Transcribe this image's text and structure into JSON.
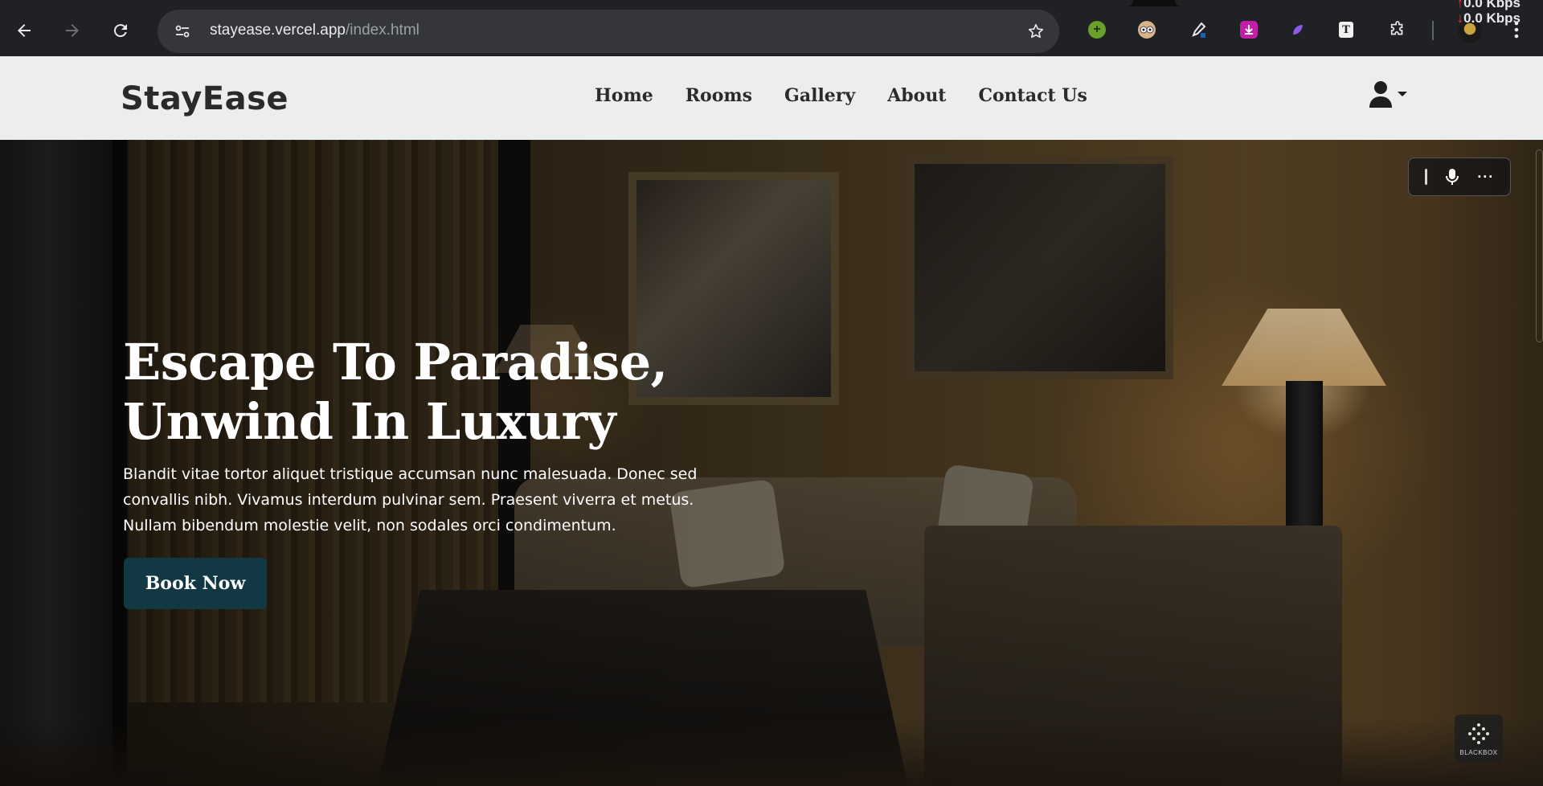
{
  "browser": {
    "url_host": "stayease.vercel.app",
    "url_path": "/index.html",
    "net_speed_up": "0.0 Kbps",
    "net_speed_down": "0.0 Kbps"
  },
  "site": {
    "brand": "StayEase",
    "nav": [
      "Home",
      "Rooms",
      "Gallery",
      "About",
      "Contact Us"
    ]
  },
  "hero": {
    "title_line1": "Escape To Paradise,",
    "title_line2": "Unwind In Luxury",
    "description": "Blandit vitae tortor aliquet tristique accumsan nunc malesuada. Donec sed convallis nibh. Vivamus interdum pulvinar sem. Praesent viverra et metus. Nullam bibendum molestie velit, non sodales orci condimentum.",
    "cta_label": "Book Now"
  },
  "badge_label": "BLACKBOX",
  "colors": {
    "header_bg": "#eceeed",
    "cta_bg": "#123844",
    "browser_bg": "#202124"
  },
  "icons": [
    "back-icon",
    "forward-icon",
    "reload-icon",
    "site-info-icon",
    "star-icon",
    "extensions-icon",
    "menu-icon",
    "user-icon",
    "mic-icon"
  ]
}
